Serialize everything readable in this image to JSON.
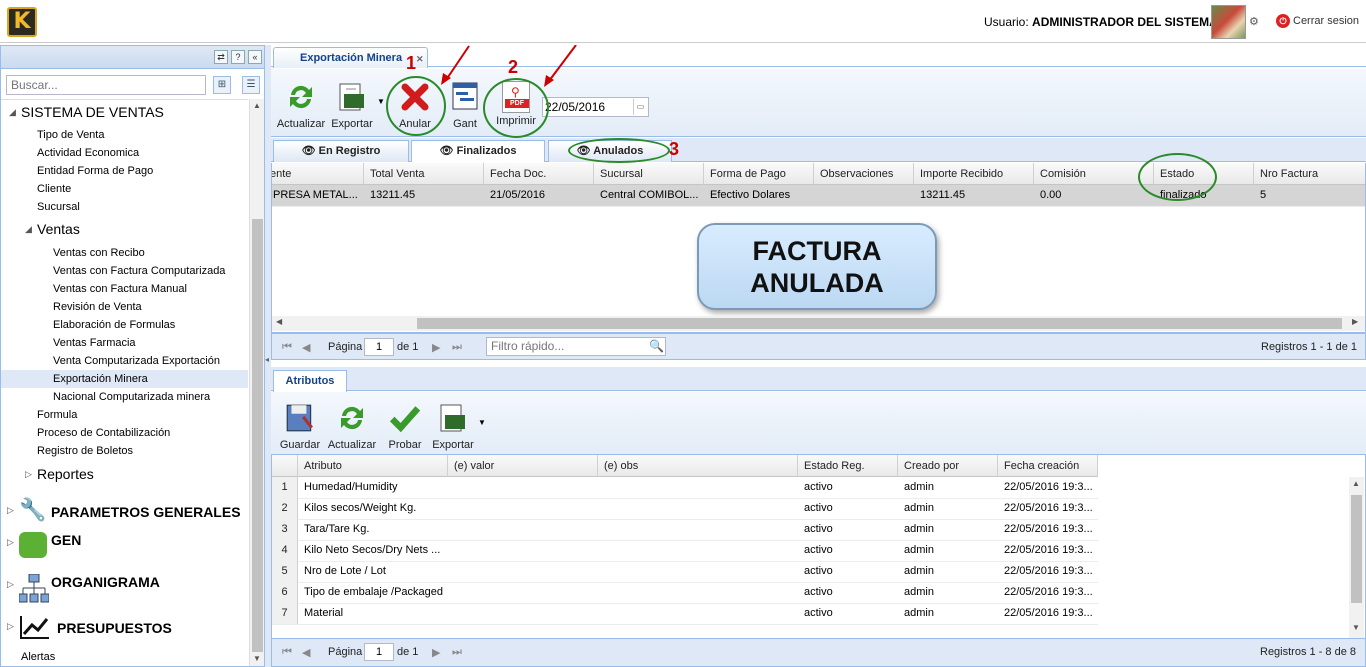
{
  "topbar": {
    "logo_letter": "K",
    "user_prefix": "Usuario:",
    "user_name": "ADMINISTRADOR DEL SISTEMA",
    "logout_label": "Cerrar sesion"
  },
  "sidebar": {
    "search_placeholder": "Buscar...",
    "tree": {
      "sistema_ventas": "SISTEMA DE VENTAS",
      "items_top": [
        "Tipo de Venta",
        "Actividad Economica",
        "Entidad Forma de Pago",
        "Cliente",
        "Sucursal"
      ],
      "ventas": "Ventas",
      "ventas_items": [
        "Ventas con Recibo",
        "Ventas con Factura Computarizada",
        "Ventas con Factura Manual",
        "Revisión de Venta",
        "Elaboración de Formulas",
        "Ventas Farmacia",
        "Venta Computarizada Exportación",
        "Exportación Minera",
        "Nacional Computarizada minera"
      ],
      "items_after": [
        "Formula",
        "Proceso de Contabilización",
        "Registro de Boletos"
      ],
      "reportes": "Reportes",
      "parametros": "PARAMETROS GENERALES",
      "gen": "GEN",
      "organigrama": "ORGANIGRAMA",
      "presupuestos": "PRESUPUESTOS",
      "alertas": "Alertas"
    }
  },
  "main": {
    "tab_title": "Exportación Minera",
    "toolbar": {
      "actualizar": "Actualizar",
      "exportar": "Exportar",
      "anular": "Anular",
      "gant": "Gant",
      "imprimir": "Imprimir",
      "date": "22/05/2016",
      "pdf_badge": "PDF"
    },
    "annotations": {
      "n1": "1",
      "n2": "2",
      "n3": "3"
    },
    "subtabs": [
      "En Registro",
      "Finalizados",
      "Anulados"
    ],
    "grid": {
      "columns": [
        "ente",
        "Total Venta",
        "Fecha Doc.",
        "Sucursal",
        "Forma de Pago",
        "Observaciones",
        "Importe Recibido",
        "Comisión",
        "Estado",
        "Nro Factura"
      ],
      "row": [
        "IPRESA METAL...",
        "13211.45",
        "21/05/2016",
        "Central COMIBOL...",
        "Efectivo Dolares",
        "",
        "13211.45",
        "0.00",
        "finalizado",
        "5"
      ]
    },
    "overlay": {
      "line1": "FACTURA",
      "line2": "ANULADA"
    },
    "pager": {
      "page_label": "Página",
      "page_value": "1",
      "of_label": "de 1",
      "filter_placeholder": "Filtro rápido...",
      "records": "Registros 1 - 1 de 1"
    }
  },
  "attributes": {
    "tab": "Atributos",
    "toolbar": {
      "guardar": "Guardar",
      "actualizar": "Actualizar",
      "probar": "Probar",
      "exportar": "Exportar"
    },
    "columns": [
      "Atributo",
      "(e) valor",
      "(e) obs",
      "Estado Reg.",
      "Creado por",
      "Fecha creación"
    ],
    "rows": [
      [
        "1",
        "Humedad/Humidity",
        "",
        "",
        "activo",
        "admin",
        "22/05/2016 19:3..."
      ],
      [
        "2",
        "Kilos secos/Weight Kg.",
        "",
        "",
        "activo",
        "admin",
        "22/05/2016 19:3..."
      ],
      [
        "3",
        "Tara/Tare Kg.",
        "",
        "",
        "activo",
        "admin",
        "22/05/2016 19:3..."
      ],
      [
        "4",
        "Kilo Neto Secos/Dry Nets ...",
        "",
        "",
        "activo",
        "admin",
        "22/05/2016 19:3..."
      ],
      [
        "5",
        "Nro de Lote / Lot",
        "",
        "",
        "activo",
        "admin",
        "22/05/2016 19:3..."
      ],
      [
        "6",
        "Tipo de embalaje /Packaged",
        "",
        "",
        "activo",
        "admin",
        "22/05/2016 19:3..."
      ],
      [
        "7",
        "Material",
        "",
        "",
        "activo",
        "admin",
        "22/05/2016 19:3..."
      ]
    ],
    "pager": {
      "page_label": "Página",
      "page_value": "1",
      "of_label": "de 1",
      "records": "Registros 1 - 8 de 8"
    }
  },
  "colors": {
    "accent": "#99bce8",
    "annotation_circle": "#2a8a2a",
    "annotation_arrow": "#c00000",
    "selected_row": "#d5d5d5"
  }
}
